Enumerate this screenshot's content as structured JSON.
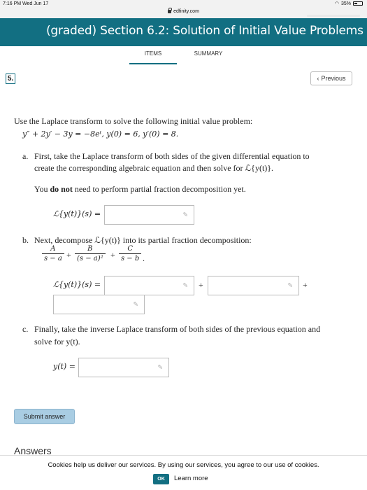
{
  "status_bar": {
    "time": "7:16 PM  Wed Jun 17",
    "battery": "35%"
  },
  "url_bar": {
    "domain": "edfinity.com"
  },
  "header": {
    "title": "(graded) Section 6.2: Solution of Initial Value Problems"
  },
  "tabs": [
    {
      "label": "ITEMS",
      "active": true
    },
    {
      "label": "SUMMARY",
      "active": false
    }
  ],
  "problem": {
    "number": "5.",
    "previous_label": "Previous",
    "intro": "Use the Laplace transform to solve the following initial value problem:",
    "equation": "y″ + 2y′ − 3y = −8eᵗ,   y(0) = 6,   y′(0) = 8.",
    "part_a": {
      "marker": "a.",
      "line1": "First, take the Laplace transform of both sides of the given differential equation to",
      "line2": "create the corresponding algebraic equation and then solve for ℒ{y(t)}.",
      "note_pre": "You ",
      "note_bold": "do not",
      "note_post": " need to perform partial fraction decomposition yet.",
      "answer_label": "ℒ{y(t)}(s) =",
      "answer_value": ""
    },
    "part_b": {
      "marker": "b.",
      "line1": "Next, decompose ℒ{y(t)} into its partial fraction decomposition:",
      "frac1_num": "A",
      "frac1_den": "s − a",
      "frac2_num": "B",
      "frac2_den": "(s − a)²",
      "frac3_num": "C",
      "frac3_den": "s − b",
      "plus": "+",
      "period": ".",
      "answer_label": "ℒ{y(t)}(s) =",
      "answer_value_1": "",
      "answer_value_2": "",
      "answer_value_3": ""
    },
    "part_c": {
      "marker": "c.",
      "line1": "Finally, take the inverse Laplace transform of both sides of the previous equation and",
      "line2": "solve for y(t).",
      "answer_label": "y(t) =",
      "answer_value": ""
    },
    "submit_label": "Submit answer",
    "answers_heading": "Answers"
  },
  "cookie_banner": {
    "message": "Cookies help us deliver our services. By using our services, you agree to our use of cookies.",
    "ok_label": "OK",
    "learn_more_label": "Learn more"
  },
  "colors": {
    "header_bg": "#126f82",
    "submit_bg": "#a9cde3"
  }
}
